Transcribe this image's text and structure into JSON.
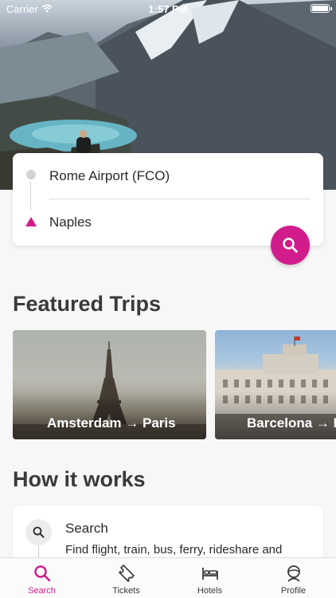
{
  "status_bar": {
    "carrier": "Carrier",
    "time": "1:57 PM"
  },
  "search": {
    "origin": "Rome Airport (FCO)",
    "destination": "Naples"
  },
  "featured": {
    "title": "Featured Trips",
    "trips": [
      {
        "label": "Amsterdam → Paris"
      },
      {
        "label": "Barcelona → M"
      }
    ]
  },
  "how_it_works": {
    "title": "How it works",
    "steps": [
      {
        "title": "Search",
        "description": "Find flight, train, bus, ferry, rideshare and"
      }
    ]
  },
  "tabbar": {
    "items": [
      {
        "label": "Search",
        "icon": "search-icon",
        "active": true
      },
      {
        "label": "Tickets",
        "icon": "ticket-icon"
      },
      {
        "label": "Hotels",
        "icon": "bed-icon"
      },
      {
        "label": "Profile",
        "icon": "person-icon"
      }
    ]
  },
  "colors": {
    "accent": "#d11c8c",
    "background": "#f7f7f7",
    "card": "#ffffff"
  }
}
